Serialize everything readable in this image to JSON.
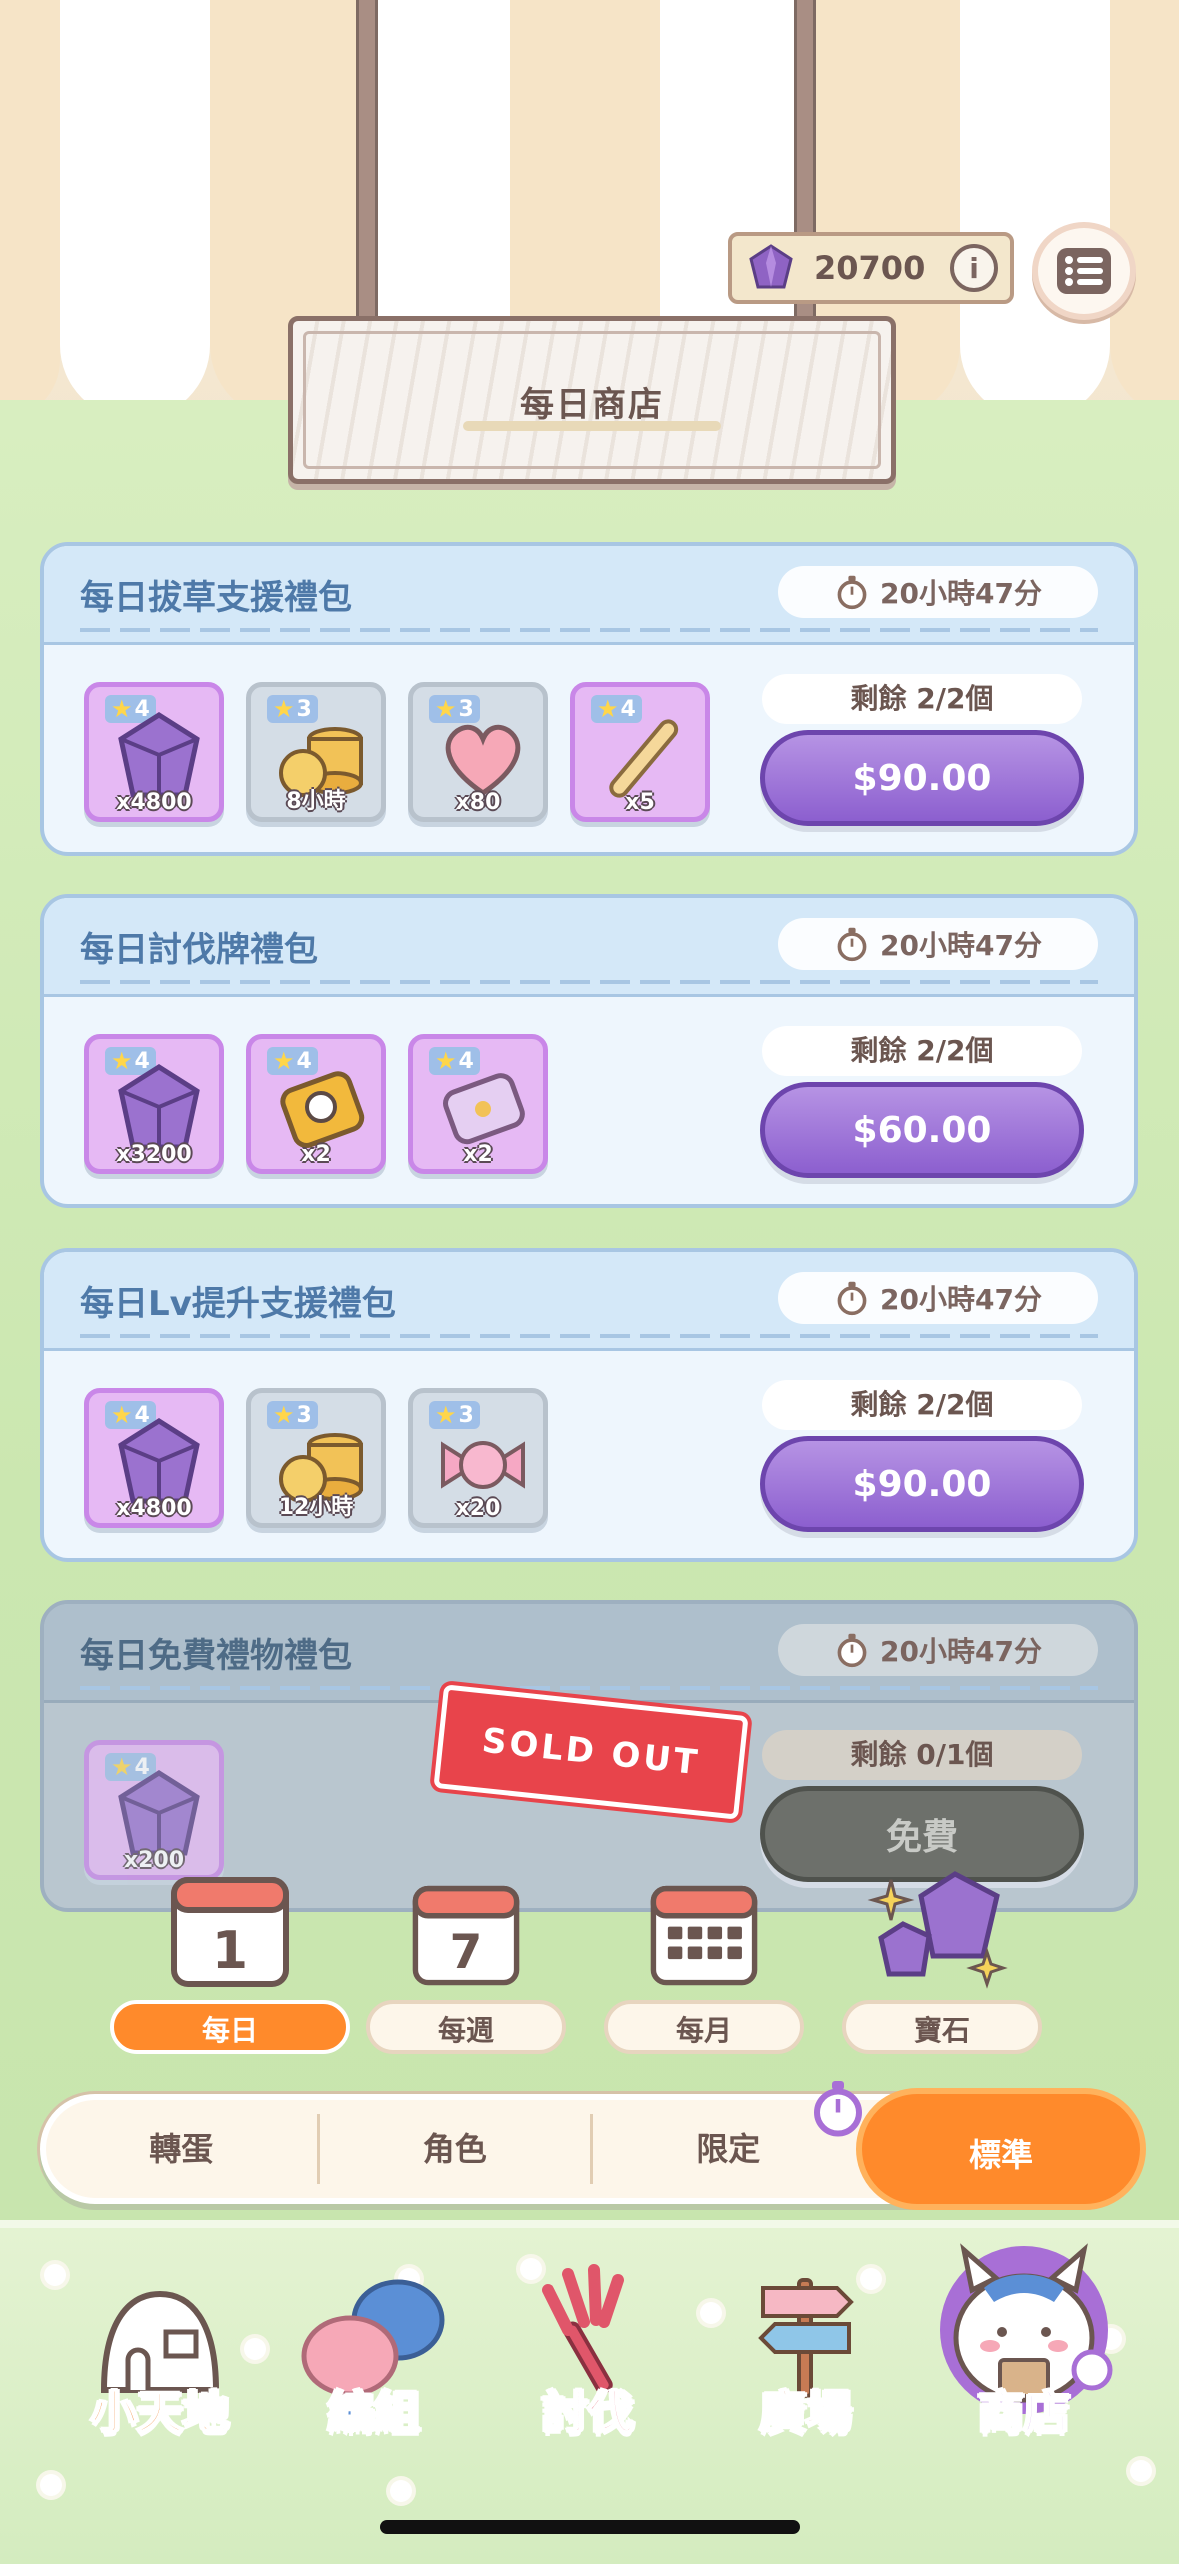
{
  "header": {
    "shop_title": "每日商店",
    "currency_amount": "20700",
    "currency_icon": "gem-icon",
    "info_icon": "info-icon",
    "menu_icon": "list-icon"
  },
  "packs": [
    {
      "name": "每日拔草支援禮包",
      "timer": "20小時47分",
      "remaining": "剩餘 2/2個",
      "price": "$90.00",
      "items": [
        {
          "icon": "gem-icon",
          "stars": "4",
          "qty": "x4800",
          "color": "purple"
        },
        {
          "icon": "coins-icon",
          "stars": "3",
          "qty": "8小時",
          "color": "gray"
        },
        {
          "icon": "heart-icon",
          "stars": "3",
          "qty": "x80",
          "color": "gray"
        },
        {
          "icon": "stick-icon",
          "stars": "4",
          "qty": "x5",
          "color": "purple"
        }
      ]
    },
    {
      "name": "每日討伐牌禮包",
      "timer": "20小時47分",
      "remaining": "剩餘 2/2個",
      "price": "$60.00",
      "items": [
        {
          "icon": "gem-icon",
          "stars": "4",
          "qty": "x3200",
          "color": "purple"
        },
        {
          "icon": "card-icon",
          "stars": "4",
          "qty": "x2",
          "color": "purple"
        },
        {
          "icon": "ticket-icon",
          "stars": "4",
          "qty": "x2",
          "color": "purple"
        }
      ]
    },
    {
      "name": "每日Lv提升支援禮包",
      "timer": "20小時47分",
      "remaining": "剩餘 2/2個",
      "price": "$90.00",
      "items": [
        {
          "icon": "gem-icon",
          "stars": "4",
          "qty": "x4800",
          "color": "purple"
        },
        {
          "icon": "coins-icon",
          "stars": "3",
          "qty": "12小時",
          "color": "gray"
        },
        {
          "icon": "candy-icon",
          "stars": "3",
          "qty": "x20",
          "color": "gray"
        }
      ]
    },
    {
      "name": "每日免費禮物禮包",
      "timer": "20小時47分",
      "remaining": "剩餘 0/1個",
      "price": "免費",
      "sold_out_label": "SOLD OUT",
      "items": [
        {
          "icon": "gem-icon",
          "stars": "4",
          "qty": "x200",
          "color": "purple"
        }
      ]
    }
  ],
  "categories": [
    {
      "label": "每日",
      "icon": "calendar-1-icon",
      "active": true
    },
    {
      "label": "每週",
      "icon": "calendar-7-icon",
      "active": false
    },
    {
      "label": "每月",
      "icon": "calendar-month-icon",
      "active": false
    },
    {
      "label": "寶石",
      "icon": "gems-icon",
      "active": false
    }
  ],
  "segments": {
    "gacha": "轉蛋",
    "character": "角色",
    "limited": "限定",
    "standard": "標準",
    "selected": "標準"
  },
  "nav": [
    {
      "label": "小天地",
      "icon": "home-icon",
      "color": "#f08a3c"
    },
    {
      "label": "編組",
      "icon": "team-icon",
      "color": "#5b8fd6"
    },
    {
      "label": "討伐",
      "icon": "fork-icon",
      "color": "#e0566a"
    },
    {
      "label": "廣場",
      "icon": "signpost-icon",
      "color": "#c77b54"
    },
    {
      "label": "商店",
      "icon": "shop-icon",
      "color": "#a86fd6"
    }
  ],
  "colors": {
    "accent_orange": "#ff8a2b",
    "price_purple": "#8c5fcf",
    "pack_title_blue": "#4e79a8",
    "sold_out_red": "#e8444b"
  }
}
